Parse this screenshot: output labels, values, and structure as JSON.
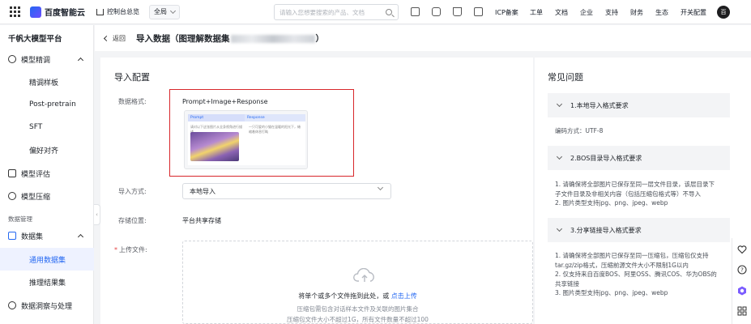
{
  "topbar": {
    "logo_text": "百度智能云",
    "console_link": "控制台总览",
    "region": "全局",
    "search_placeholder": "请输入您想要搜索的产品、文档",
    "nav": [
      "ICP备案",
      "工单",
      "文档",
      "企业",
      "支持",
      "财务",
      "生态",
      "开关配置"
    ],
    "avatar_initial": "百"
  },
  "sidebar": {
    "title": "千帆大模型平台",
    "items": [
      {
        "label": "模型精调",
        "icon": "model-tune-icon",
        "expanded": true
      },
      {
        "label": "精调样板"
      },
      {
        "label": "Post-pretrain"
      },
      {
        "label": "SFT"
      },
      {
        "label": "偏好对齐"
      },
      {
        "label": "模型评估",
        "icon": "model-eval-icon"
      },
      {
        "label": "模型压缩",
        "icon": "model-compress-icon"
      },
      {
        "group": "数据管理"
      },
      {
        "label": "数据集",
        "icon": "dataset-icon",
        "expanded": true
      },
      {
        "label": "通用数据集",
        "active": true
      },
      {
        "label": "推理结果集"
      },
      {
        "label": "数据洞察与处理",
        "icon": "data-insight-icon"
      }
    ]
  },
  "header": {
    "back_label": "返回",
    "title_prefix": "导入数据（图理解数据集",
    "title_suffix": "）"
  },
  "form": {
    "section_title": "导入配置",
    "format_label": "数据格式:",
    "format_value": "Prompt+Image+Response",
    "preview": {
      "col1": "Prompt",
      "col2": "Response",
      "prompt_text": "请对以下这张图片从全身视角进行描述",
      "response_text": "一只可爱的小猫在温暖的阳光下，蜷缩着休息打盹"
    },
    "import_label": "导入方式:",
    "import_value": "本地导入",
    "storage_label": "存储位置:",
    "storage_value": "平台共享存储",
    "upload_label": "上传文件:",
    "upload_required": "*",
    "upload_main": "将单个或多个文件拖到此处，或",
    "upload_link": "点击上传",
    "upload_hint1": "压缩包需包含对话样本文件及关联的图片集合",
    "upload_hint2": "压缩包文件大小不超过1G，所有文件数量不超过100"
  },
  "faq": {
    "title": "常见问题",
    "items": [
      {
        "title": "1.本地导入格式要求",
        "lines": [
          "编码方式：UTF-8"
        ]
      },
      {
        "title": "2.BOS目录导入格式要求",
        "lines": [
          "1. 请确保将全部图片已保存至同一层文件目录，该层目录下",
          "子文件目录及非相关内容（包括压缩包格式等）不导入",
          "2. 图片类型支持jpg、png、jpeg、webp"
        ]
      },
      {
        "title": "3.分享链接导入格式要求",
        "lines": [
          "1. 请确保将全部图片已保存至同一压缩包，压缩包仅支持",
          "tar.gz/zip格式，压缩前源文件大小不限制1G以内",
          "2. 仅支持来自百度BOS、阿里OSS、腾讯COS、华为OBS的",
          "共享链接",
          "3. 图片类型支持jpg、png、jpeg、webp"
        ]
      }
    ]
  },
  "colors": {
    "accent": "#2468f2",
    "highlight_border": "#d8272b",
    "required": "#e54545"
  }
}
